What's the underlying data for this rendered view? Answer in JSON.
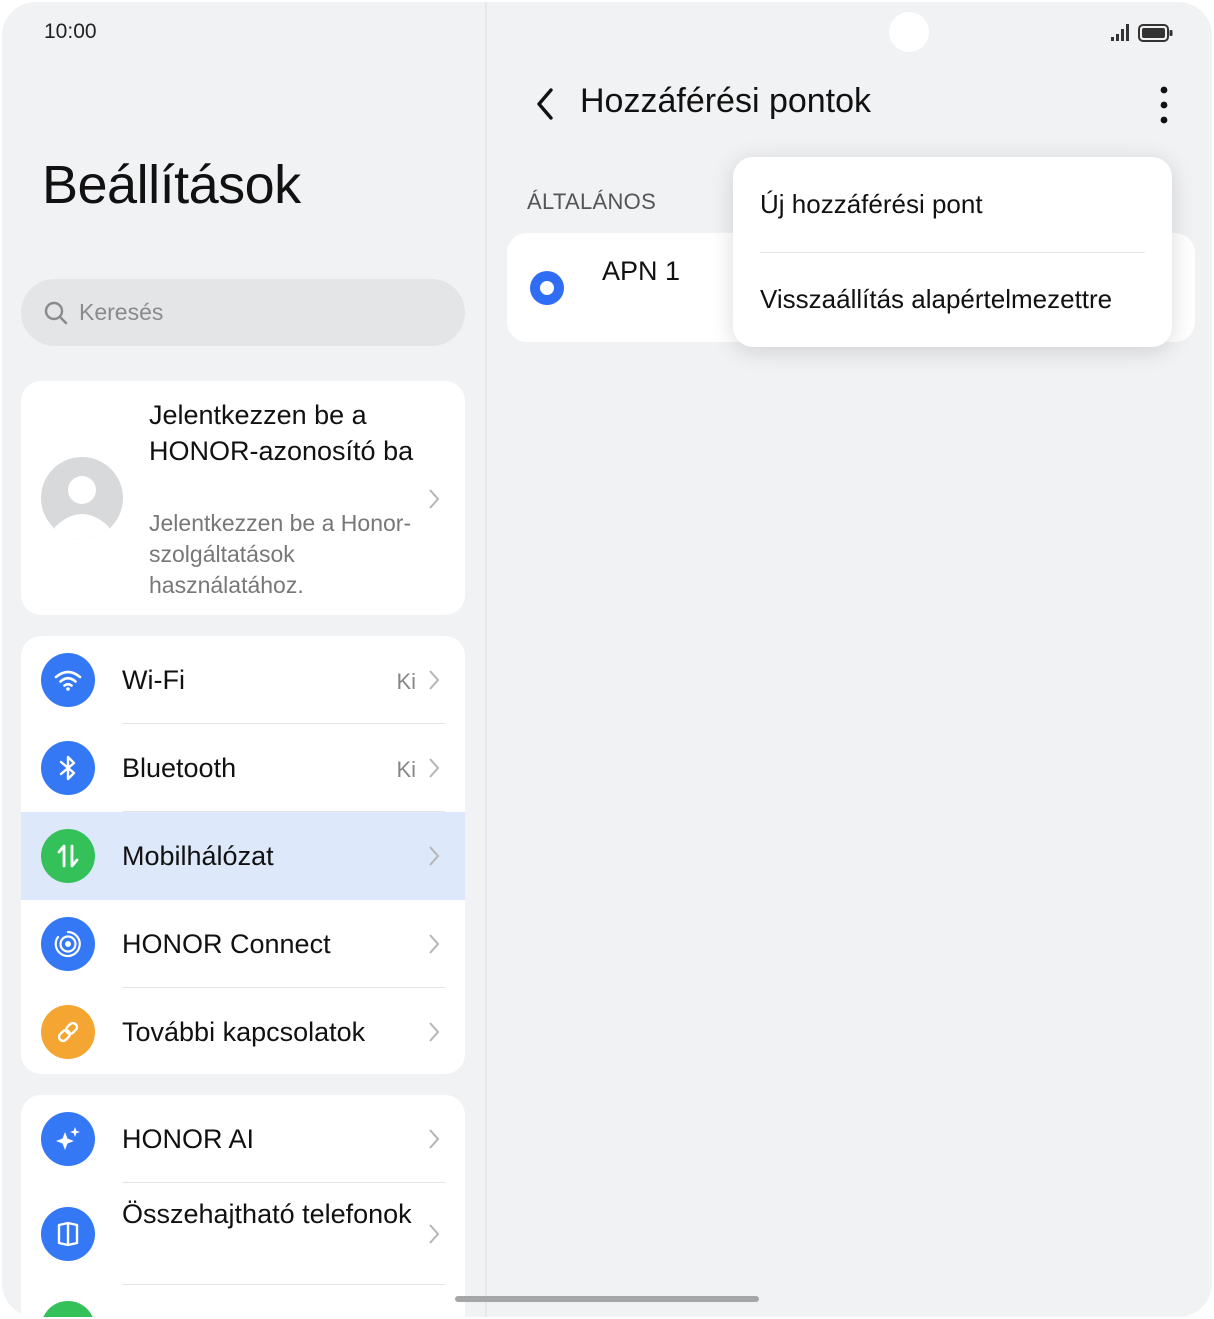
{
  "status_bar": {
    "time": "10:00"
  },
  "settings": {
    "title": "Beállítások",
    "search": {
      "placeholder": "Keresés"
    },
    "account": {
      "title": "Jelentkezzen be a HONOR-azonosító ba",
      "subtitle": "Jelentkezzen be a Honor-szolgáltatások használatához."
    },
    "group1": [
      {
        "label": "Wi-Fi",
        "value": "Ki",
        "icon": "wifi-icon",
        "color": "#3478f6"
      },
      {
        "label": "Bluetooth",
        "value": "Ki",
        "icon": "bluetooth-icon",
        "color": "#3478f6"
      },
      {
        "label": "Mobilhálózat",
        "value": "",
        "icon": "mobile-data-icon",
        "color": "#34c15a"
      },
      {
        "label": "HONOR Connect",
        "value": "",
        "icon": "honor-connect-icon",
        "color": "#3478f6"
      },
      {
        "label": "További kapcsolatok",
        "value": "",
        "icon": "link-icon",
        "color": "#f5a531"
      }
    ],
    "group2": [
      {
        "label": "HONOR AI",
        "icon": "ai-sparkle-icon",
        "color": "#3478f6"
      },
      {
        "label": "Összehajtható telefonok",
        "icon": "foldable-icon",
        "color": "#3478f6"
      }
    ]
  },
  "apn": {
    "title": "Hozzáférési pontok",
    "section": "ÁLTALÁNOS",
    "items": [
      {
        "name": "APN 1",
        "selected": true
      }
    ],
    "menu": [
      "Új hozzáférési pont",
      "Visszaállítás alapértelmezettre"
    ]
  },
  "colors": {
    "accent": "#2f6df6",
    "highlight": "#dde8fb",
    "background": "#f1f2f4"
  }
}
